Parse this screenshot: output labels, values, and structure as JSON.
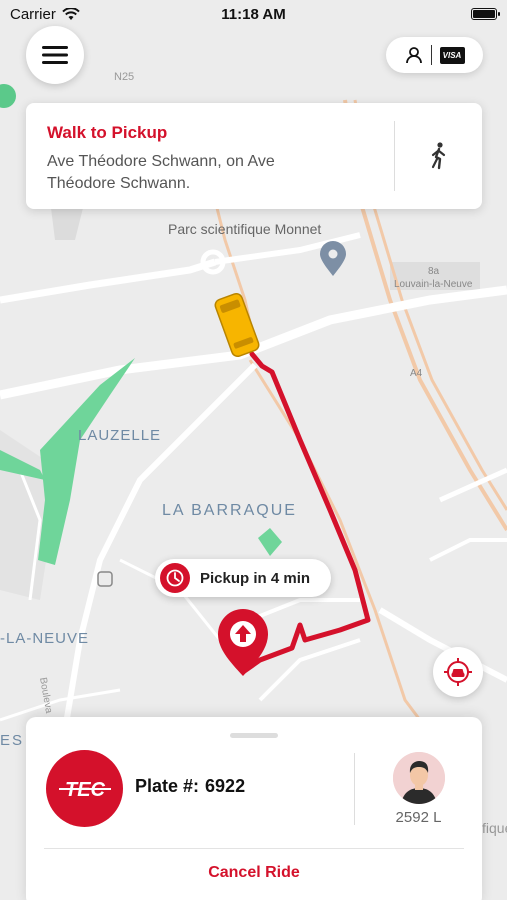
{
  "status_bar": {
    "carrier": "Carrier",
    "time": "11:18 AM"
  },
  "map": {
    "labels": {
      "road_n25": "N25",
      "parc": "Parc scientifique Monnet",
      "area_8a": "8a",
      "louvain": "Louvain-la-Neuve",
      "road_a4": "A4",
      "lauzelle": "LAUZELLE",
      "barraque": "LA BARRAQUE",
      "la_neuve": "-LA-NEUVE",
      "boulevard": "Bouleva",
      "es": "ES",
      "fique": "fique"
    }
  },
  "instruction": {
    "title": "Walk to Pickup",
    "address": "Ave Théodore Schwann, on Ave Théodore Schwann.",
    "icon": "walking-person-icon"
  },
  "pickup": {
    "label": "Pickup in 4 min",
    "icon": "clock-icon"
  },
  "ride": {
    "operator_logo": "TEC",
    "plate_label": "Plate #:",
    "plate_number": "6922",
    "driver_rating": "2592 L",
    "cancel_label": "Cancel Ride"
  },
  "colors": {
    "accent": "#d4112b",
    "route": "#d4112b",
    "map_bg": "#ececec",
    "park": "#6fd59a",
    "highway": "#f2c9a8",
    "bus": "#f7b500"
  }
}
